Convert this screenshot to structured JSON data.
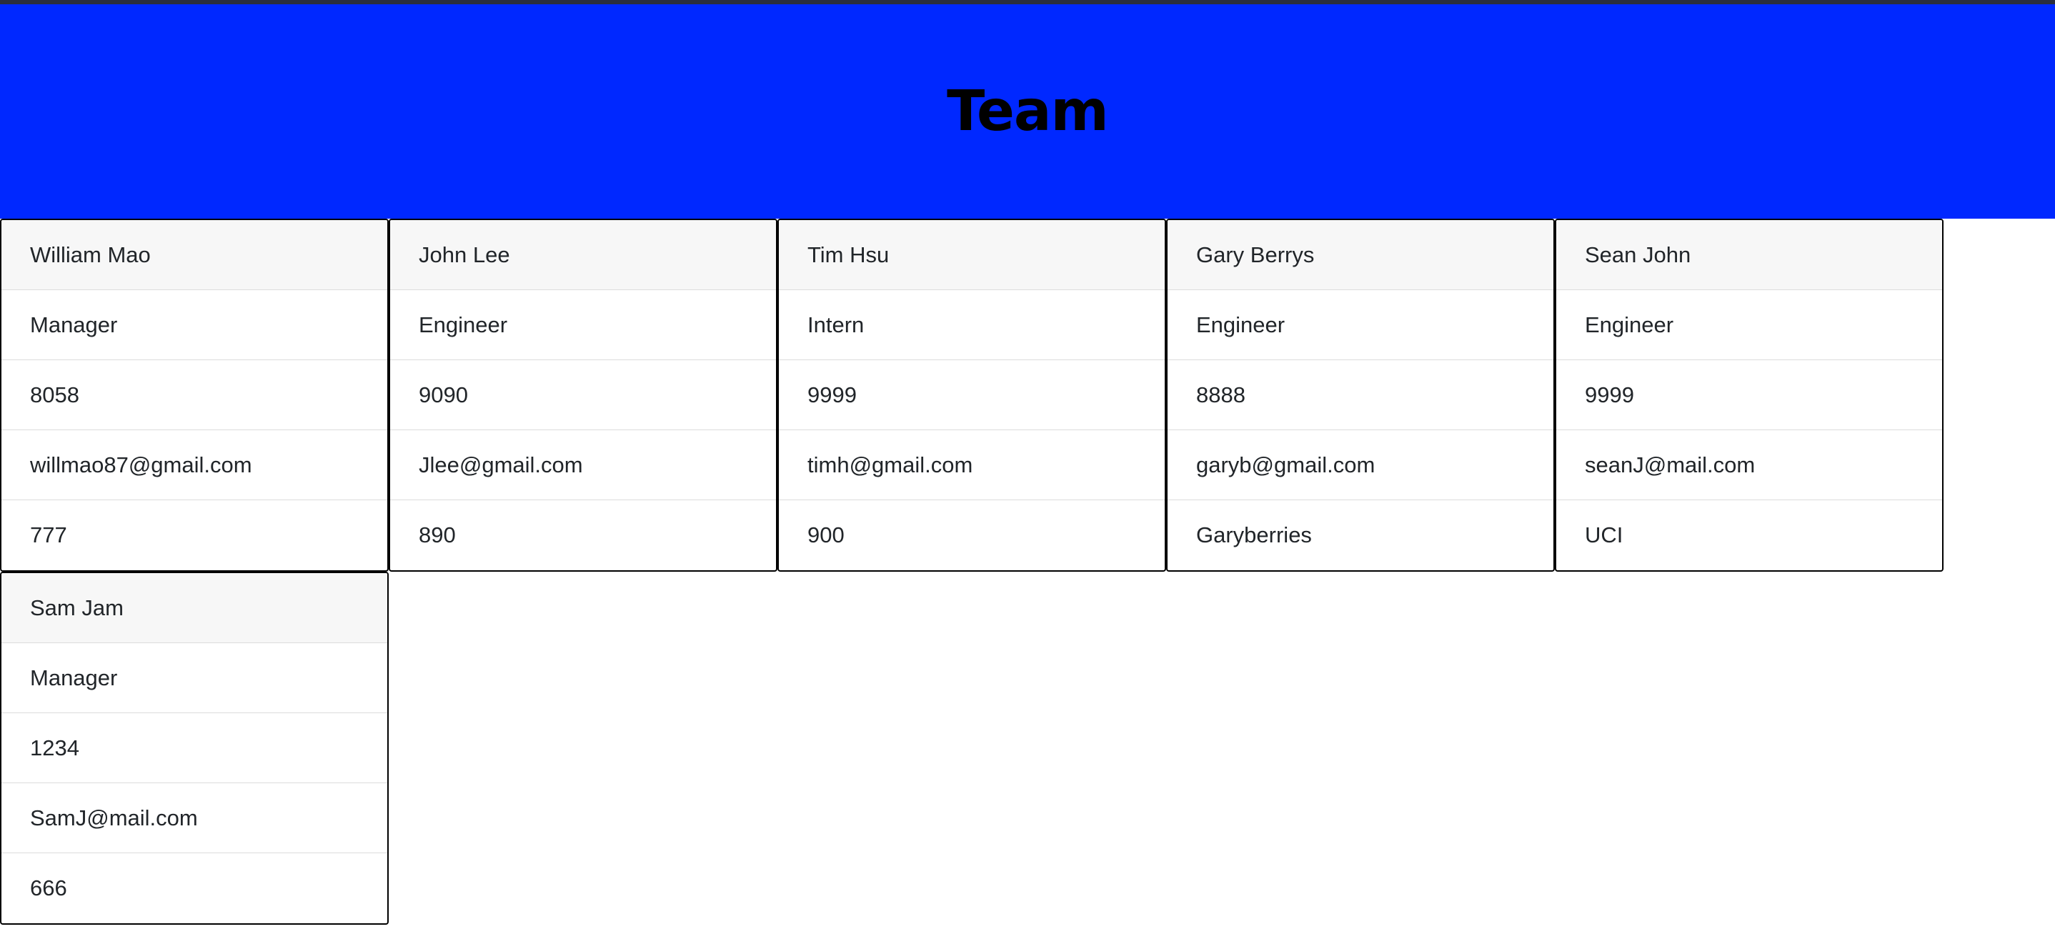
{
  "header": {
    "title": "Team"
  },
  "team": [
    {
      "name": "William Mao",
      "role": "Manager",
      "id": "8058",
      "email": "willmao87@gmail.com",
      "extra": "777"
    },
    {
      "name": "John Lee",
      "role": "Engineer",
      "id": "9090",
      "email": "Jlee@gmail.com",
      "extra": "890"
    },
    {
      "name": "Tim Hsu",
      "role": "Intern",
      "id": "9999",
      "email": "timh@gmail.com",
      "extra": "900"
    },
    {
      "name": "Gary Berrys",
      "role": "Engineer",
      "id": "8888",
      "email": "garyb@gmail.com",
      "extra": "Garyberries"
    },
    {
      "name": "Sean John",
      "role": "Engineer",
      "id": "9999",
      "email": "seanJ@mail.com",
      "extra": "UCI"
    },
    {
      "name": "Sam Jam",
      "role": "Manager",
      "id": "1234",
      "email": "SamJ@mail.com",
      "extra": "666"
    }
  ],
  "colors": {
    "header_bg": "#0028ff",
    "top_bar": "#2a2e3e",
    "card_border": "#000000",
    "card_header_bg": "#f7f7f7"
  }
}
